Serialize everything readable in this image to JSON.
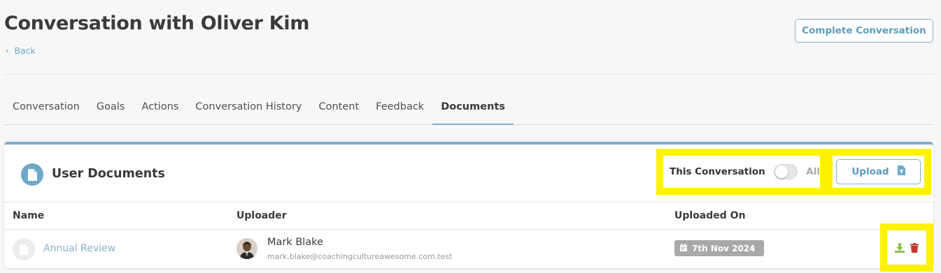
{
  "header": {
    "title": "Conversation with Oliver Kim",
    "back_label": "Back",
    "complete_button": "Complete Conversation"
  },
  "tabs": [
    {
      "label": "Conversation",
      "active": false
    },
    {
      "label": "Goals",
      "active": false
    },
    {
      "label": "Actions",
      "active": false
    },
    {
      "label": "Conversation History",
      "active": false
    },
    {
      "label": "Content",
      "active": false
    },
    {
      "label": "Feedback",
      "active": false
    },
    {
      "label": "Documents",
      "active": true
    }
  ],
  "documents_card": {
    "title": "User Documents",
    "icon": "document-icon",
    "toggle": {
      "left_label": "This Conversation",
      "right_label": "All",
      "on": false
    },
    "upload_button": "Upload",
    "columns": {
      "name": "Name",
      "uploader": "Uploader",
      "uploaded_on": "Uploaded On"
    },
    "rows": [
      {
        "name": "Annual Review",
        "uploader_name": "Mark Blake",
        "uploader_email": "mark.blake@coachingcultureawesome.com.test",
        "uploaded_on": "7th Nov 2024"
      }
    ]
  },
  "colors": {
    "accent": "#7fb0cc",
    "link": "#86b2cd",
    "highlight": "#fff200",
    "download": "#8cc152",
    "delete": "#c0392b",
    "date_badge": "#a8a8a8"
  }
}
